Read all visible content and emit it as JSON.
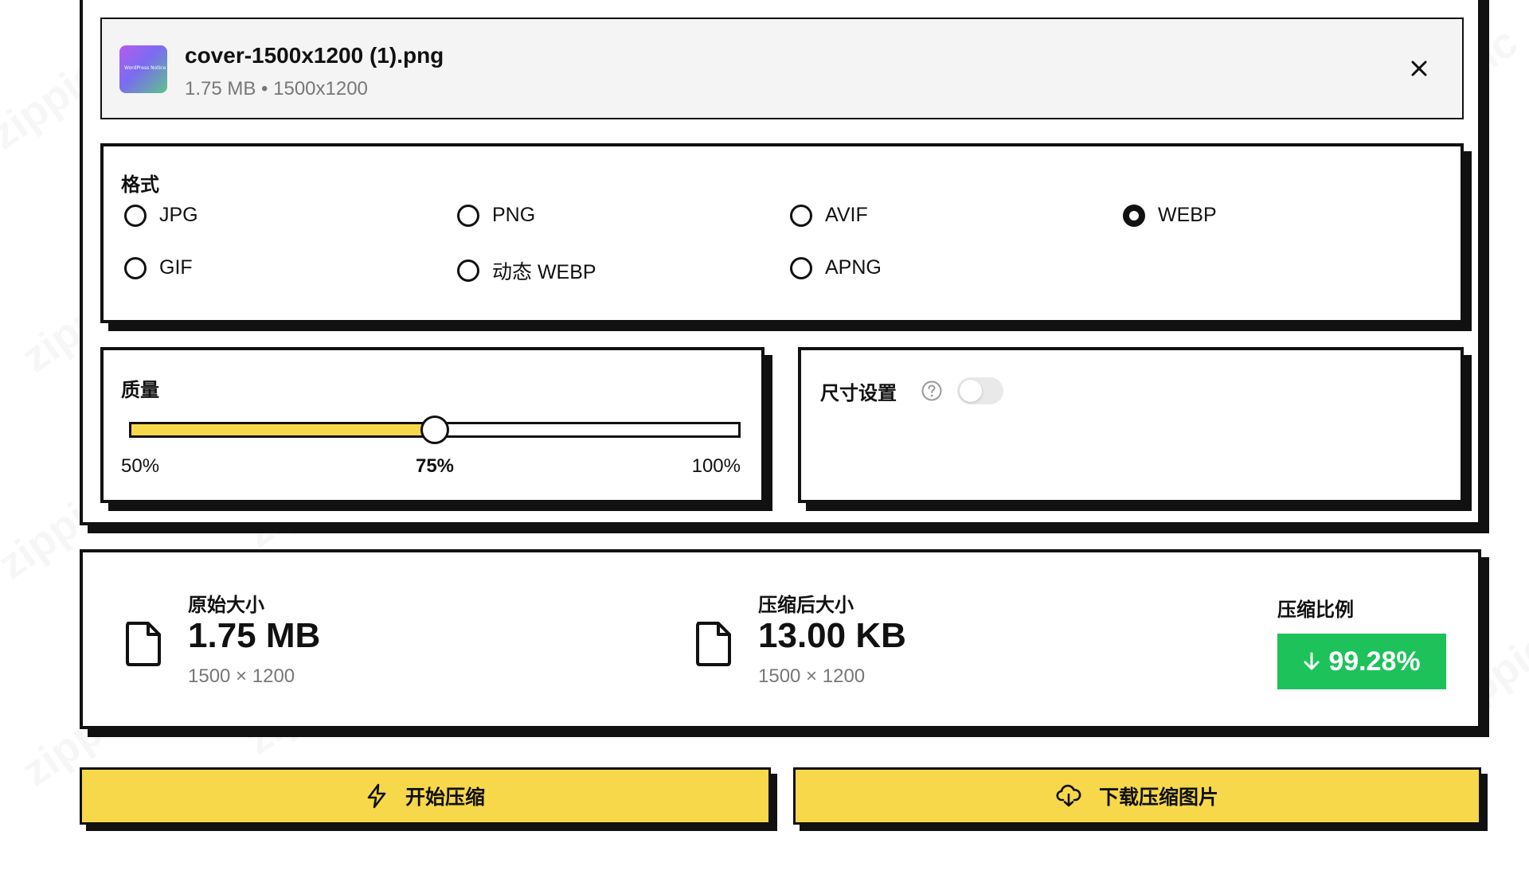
{
  "file": {
    "name": "cover-1500x1200 (1).png",
    "meta": "1.75 MB • 1500x1200",
    "thumb_text": "WordPress Notice"
  },
  "format": {
    "title": "格式",
    "options": [
      {
        "label": "JPG",
        "selected": false
      },
      {
        "label": "PNG",
        "selected": false
      },
      {
        "label": "AVIF",
        "selected": false
      },
      {
        "label": "WEBP",
        "selected": true
      },
      {
        "label": "GIF",
        "selected": false
      },
      {
        "label": "动态 WEBP",
        "selected": false
      },
      {
        "label": "APNG",
        "selected": false
      }
    ]
  },
  "quality": {
    "title": "质量",
    "min_label": "50%",
    "current_label": "75%",
    "max_label": "100%",
    "value_fraction": 0.5
  },
  "size_settings": {
    "title": "尺寸设置",
    "enabled": false
  },
  "stats": {
    "original": {
      "label": "原始大小",
      "value": "1.75 MB",
      "dims": "1500 × 1200"
    },
    "compressed": {
      "label": "压缩后大小",
      "value": "13.00 KB",
      "dims": "1500 × 1200"
    },
    "ratio": {
      "label": "压缩比例",
      "value": "99.28%"
    }
  },
  "actions": {
    "compress_label": "开始压缩",
    "download_label": "下载压缩图片"
  },
  "watermark": "zippic",
  "colors": {
    "accent_yellow": "#f7d84a",
    "success_green": "#1dc25a",
    "border": "#111111"
  }
}
